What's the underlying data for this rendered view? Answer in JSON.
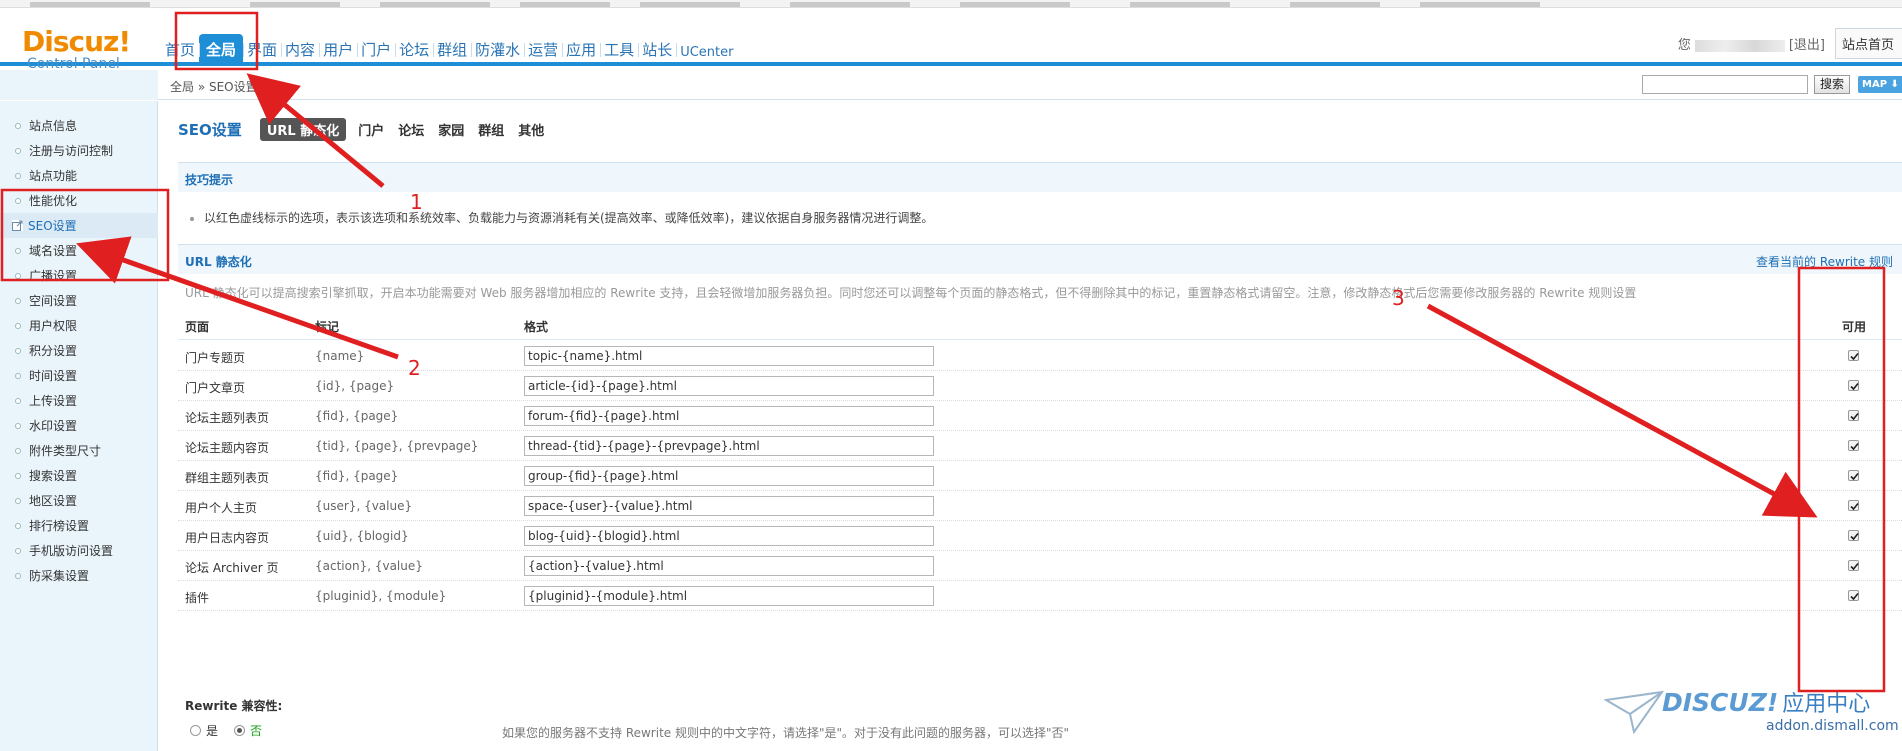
{
  "header": {
    "logo_main": "Discuz!",
    "logo_sub": "Control Panel",
    "nav": [
      {
        "label": "首页",
        "active": false
      },
      {
        "label": "全局",
        "active": true
      },
      {
        "label": "界面",
        "active": false
      },
      {
        "label": "内容",
        "active": false
      },
      {
        "label": "用户",
        "active": false
      },
      {
        "label": "门户",
        "active": false
      },
      {
        "label": "论坛",
        "active": false
      },
      {
        "label": "群组",
        "active": false
      },
      {
        "label": "防灌水",
        "active": false
      },
      {
        "label": "运营",
        "active": false
      },
      {
        "label": "应用",
        "active": false
      },
      {
        "label": "工具",
        "active": false
      },
      {
        "label": "站长",
        "active": false
      },
      {
        "label": "UCenter",
        "active": false
      }
    ],
    "greeting_prefix": "您",
    "greeting_suffix": "[退出]",
    "site_home": "站点首页"
  },
  "breadcrumb": {
    "text": "全局 » SEO设置 [+]",
    "search_button": "搜索",
    "map_button": "MAP ⬇"
  },
  "sidebar": {
    "items": [
      {
        "label": "站点信息"
      },
      {
        "label": "注册与访问控制"
      },
      {
        "label": "站点功能"
      },
      {
        "label": "性能优化"
      },
      {
        "label": "SEO设置",
        "active": true
      },
      {
        "label": "域名设置"
      },
      {
        "label": "广播设置"
      },
      {
        "label": "空间设置"
      },
      {
        "label": "用户权限"
      },
      {
        "label": "积分设置"
      },
      {
        "label": "时间设置"
      },
      {
        "label": "上传设置"
      },
      {
        "label": "水印设置"
      },
      {
        "label": "附件类型尺寸"
      },
      {
        "label": "搜索设置"
      },
      {
        "label": "地区设置"
      },
      {
        "label": "排行榜设置"
      },
      {
        "label": "手机版访问设置"
      },
      {
        "label": "防采集设置"
      }
    ]
  },
  "main": {
    "title": "SEO设置",
    "tabs": [
      {
        "label": "URL 静态化",
        "active": true
      },
      {
        "label": "门户"
      },
      {
        "label": "论坛"
      },
      {
        "label": "家园"
      },
      {
        "label": "群组"
      },
      {
        "label": "其他"
      }
    ],
    "tips_header": "技巧提示",
    "tip_text": "以红色虚线标示的选项，表示该选项和系统效率、负载能力与资源消耗有关(提高效率、或降低效率)，建议依据自身服务器情况进行调整。",
    "url_header": "URL 静态化",
    "rewrite_link": "查看当前的 Rewrite 规则",
    "description": "URL 静态化可以提高搜索引擎抓取，开启本功能需要对 Web 服务器增加相应的 Rewrite 支持，且会轻微增加服务器负担。同时您还可以调整每个页面的静态格式，但不得删除其中的标记，重置静态格式请留空。注意，修改静态格式后您需要修改服务器的 Rewrite 规则设置",
    "columns": {
      "page": "页面",
      "mark": "标记",
      "format": "格式",
      "enabled": "可用"
    },
    "rows": [
      {
        "page": "门户专题页",
        "mark": "{name}",
        "format": "topic-{name}.html",
        "enabled": true
      },
      {
        "page": "门户文章页",
        "mark": "{id}, {page}",
        "format": "article-{id}-{page}.html",
        "enabled": true
      },
      {
        "page": "论坛主题列表页",
        "mark": "{fid}, {page}",
        "format": "forum-{fid}-{page}.html",
        "enabled": true
      },
      {
        "page": "论坛主题内容页",
        "mark": "{tid}, {page}, {prevpage}",
        "format": "thread-{tid}-{page}-{prevpage}.html",
        "enabled": true
      },
      {
        "page": "群组主题列表页",
        "mark": "{fid}, {page}",
        "format": "group-{fid}-{page}.html",
        "enabled": true
      },
      {
        "page": "用户个人主页",
        "mark": "{user}, {value}",
        "format": "space-{user}-{value}.html",
        "enabled": true
      },
      {
        "page": "用户日志内容页",
        "mark": "{uid}, {blogid}",
        "format": "blog-{uid}-{blogid}.html",
        "enabled": true
      },
      {
        "page": "论坛 Archiver 页",
        "mark": "{action}, {value}",
        "format": "{action}-{value}.html",
        "enabled": true
      },
      {
        "page": "插件",
        "mark": "{pluginid}, {module}",
        "format": "{pluginid}-{module}.html",
        "enabled": true
      }
    ],
    "rewrite_compat_label": "Rewrite 兼容性:",
    "radio_yes": "是",
    "radio_no": "否",
    "rewrite_compat_note": "如果您的服务器不支持 Rewrite 规则中的中文字符，请选择\"是\"。对于没有此问题的服务器，可以选择\"否\""
  },
  "annotations": {
    "labels": [
      "1",
      "2",
      "3"
    ],
    "color": "#e02020"
  },
  "watermark": {
    "brand": "DISCUZ!",
    "brand_cn": "应用中心",
    "domain": "addon.dismall.com"
  }
}
